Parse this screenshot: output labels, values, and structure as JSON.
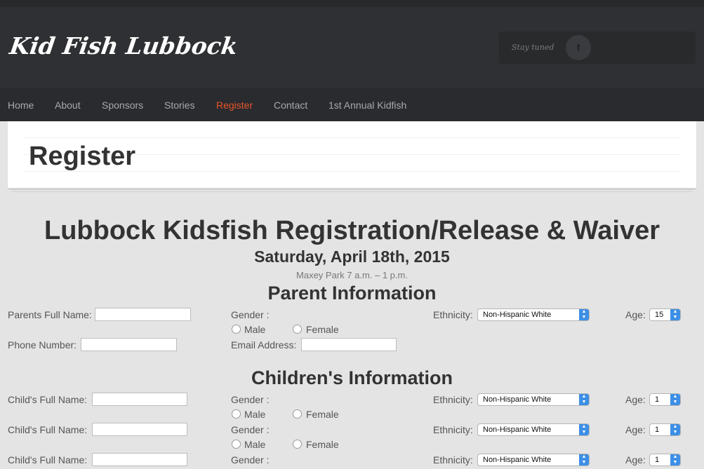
{
  "site": {
    "logo": "Kid Fish Lubbock",
    "social_label": "Stay tuned",
    "facebook_glyph": "f"
  },
  "nav": [
    {
      "label": "Home"
    },
    {
      "label": "About"
    },
    {
      "label": "Sponsors"
    },
    {
      "label": "Stories"
    },
    {
      "label": "Register",
      "active": true
    },
    {
      "label": "Contact"
    },
    {
      "label": "1st Annual Kidfish"
    }
  ],
  "page": {
    "title": "Register"
  },
  "form": {
    "heading": "Lubbock Kidsfish Registration/Release & Waiver",
    "date": "Saturday, April 18th, 2015",
    "location": "Maxey Park 7 a.m. – 1 p.m.",
    "parent_section": "Parent Information",
    "children_section": "Children's Information",
    "parent": {
      "name_label": "Parents Full Name:",
      "gender_label": "Gender :",
      "male_label": "Male",
      "female_label": "Female",
      "ethnicity_label": "Ethnicity:",
      "ethnicity_value": "Non-Hispanic White",
      "age_label": "Age:",
      "age_value": "15",
      "phone_label": "Phone Number:",
      "email_label": "Email Address:"
    },
    "children": [
      {
        "name_label": "Child's Full Name:",
        "gender_label": "Gender :",
        "male_label": "Male",
        "female_label": "Female",
        "ethnicity_label": "Ethnicity:",
        "ethnicity_value": "Non-Hispanic White",
        "age_label": "Age:",
        "age_value": "1"
      },
      {
        "name_label": "Child's Full Name:",
        "gender_label": "Gender :",
        "male_label": "Male",
        "female_label": "Female",
        "ethnicity_label": "Ethnicity:",
        "ethnicity_value": "Non-Hispanic White",
        "age_label": "Age:",
        "age_value": "1"
      },
      {
        "name_label": "Child's Full Name:",
        "gender_label": "Gender :",
        "ethnicity_label": "Ethnicity:",
        "ethnicity_value": "Non-Hispanic White",
        "age_label": "Age:",
        "age_value": "1"
      }
    ]
  },
  "colors": {
    "accent": "#e8542a",
    "header_bg": "#2f3033",
    "page_bg": "#e4e4e4",
    "select_arrow": "#3d8fe6"
  }
}
